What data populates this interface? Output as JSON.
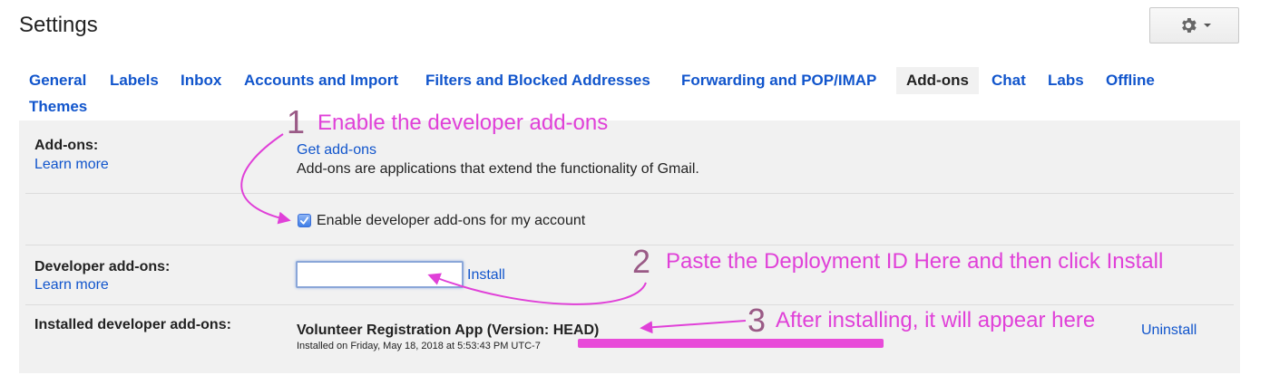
{
  "header": {
    "title": "Settings",
    "settings_icon": "gear-icon"
  },
  "tabs": [
    {
      "label": "General",
      "active": false
    },
    {
      "label": "Labels",
      "active": false
    },
    {
      "label": "Inbox",
      "active": false
    },
    {
      "label": "Accounts and Import",
      "active": false
    },
    {
      "label": "Filters and Blocked Addresses",
      "active": false
    },
    {
      "label": "Forwarding and POP/IMAP",
      "active": false
    },
    {
      "label": "Add-ons",
      "active": true
    },
    {
      "label": "Chat",
      "active": false
    },
    {
      "label": "Labs",
      "active": false
    },
    {
      "label": "Offline",
      "active": false
    },
    {
      "label": "Themes",
      "active": false
    }
  ],
  "addons": {
    "label": "Add-ons:",
    "learn_more": "Learn more",
    "get_addons": "Get add-ons",
    "description": "Add-ons are applications that extend the functionality of Gmail.",
    "enable_developer_label": "Enable developer add-ons for my account",
    "enable_developer_checked": true
  },
  "developer_addons": {
    "label": "Developer add-ons:",
    "learn_more": "Learn more",
    "input_value": "",
    "install": "Install"
  },
  "installed": {
    "label": "Installed developer add-ons:",
    "app_name": "Volunteer Registration App (Version: HEAD)",
    "installed_on": "Installed on Friday, May 18, 2018 at 5:53:43 PM UTC-7",
    "uninstall": "Uninstall"
  },
  "annotations": {
    "step1_number": "1",
    "step1_text": "Enable the developer add-ons",
    "step2_number": "2",
    "step2_text": "Paste the Deployment ID Here and then click Install",
    "step3_number": "3",
    "step3_text": "After installing, it will appear here",
    "color": "#e040d8"
  },
  "colors": {
    "link": "#1155cc",
    "panel_bg": "#f1f1f1",
    "annotation": "#e040d8"
  }
}
